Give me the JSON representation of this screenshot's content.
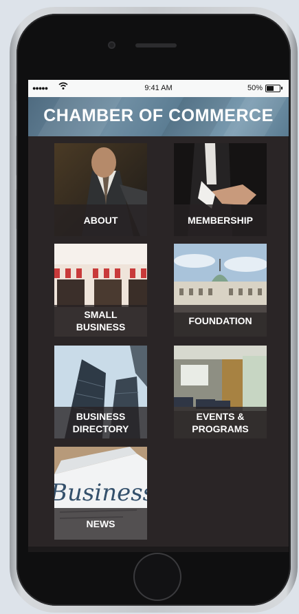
{
  "status_bar": {
    "signal": "●●●●●",
    "wifi_icon": "wifi-icon",
    "time": "9:41 AM",
    "battery_percent": "50%",
    "battery_level": 0.5
  },
  "header": {
    "title": "CHAMBER OF COMMERCE"
  },
  "tiles": [
    {
      "label": "ABOUT",
      "image": "businessman-tie-photo"
    },
    {
      "label": "MEMBERSHIP",
      "image": "handshake-offer-photo"
    },
    {
      "label": "SMALL\nBUSINESS",
      "image": "storefront-awnings-photo"
    },
    {
      "label": "FOUNDATION",
      "image": "historic-building-dome-photo"
    },
    {
      "label": "BUSINESS\nDIRECTORY",
      "image": "skyscrapers-photo"
    },
    {
      "label": "EVENTS &\nPROGRAMS",
      "image": "conference-room-photo"
    },
    {
      "label": "NEWS",
      "image": "newspaper-business-photo"
    }
  ],
  "colors": {
    "background": "#dde3ea",
    "screen_bg": "#2a2526",
    "header_accent": "#6f8ea3",
    "label_band": "#262122",
    "label_text": "#ffffff"
  }
}
